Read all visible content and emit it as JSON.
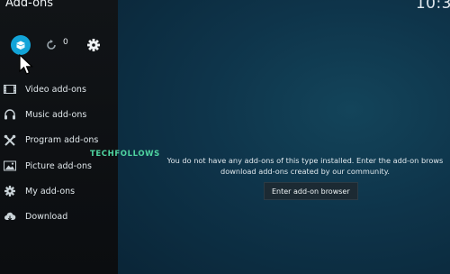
{
  "window": {
    "title": "Add-ons",
    "clock": "10:3"
  },
  "toolbar": {
    "package_icon": "open-box-icon",
    "refresh_icon": "refresh-icon",
    "update_count": "0",
    "settings_icon": "gear-icon"
  },
  "sidebar": {
    "items": [
      {
        "label": "Video add-ons",
        "icon": "film-icon"
      },
      {
        "label": "Music add-ons",
        "icon": "headphones-icon"
      },
      {
        "label": "Program add-ons",
        "icon": "tools-icon"
      },
      {
        "label": "Picture add-ons",
        "icon": "picture-icon"
      },
      {
        "label": "My add-ons",
        "icon": "gear-icon"
      },
      {
        "label": "Download",
        "icon": "cloud-download-icon"
      }
    ]
  },
  "main": {
    "message_line1": "You do not have any add-ons of this type installed. Enter the add-on brows",
    "message_line2": "download add-ons created by our community.",
    "browser_button": "Enter add-on browser"
  },
  "watermark": "TECHFOLLOWS",
  "colors": {
    "accent": "#12a4d8",
    "watermark": "#4fd4a0",
    "background": "#0e344a"
  }
}
